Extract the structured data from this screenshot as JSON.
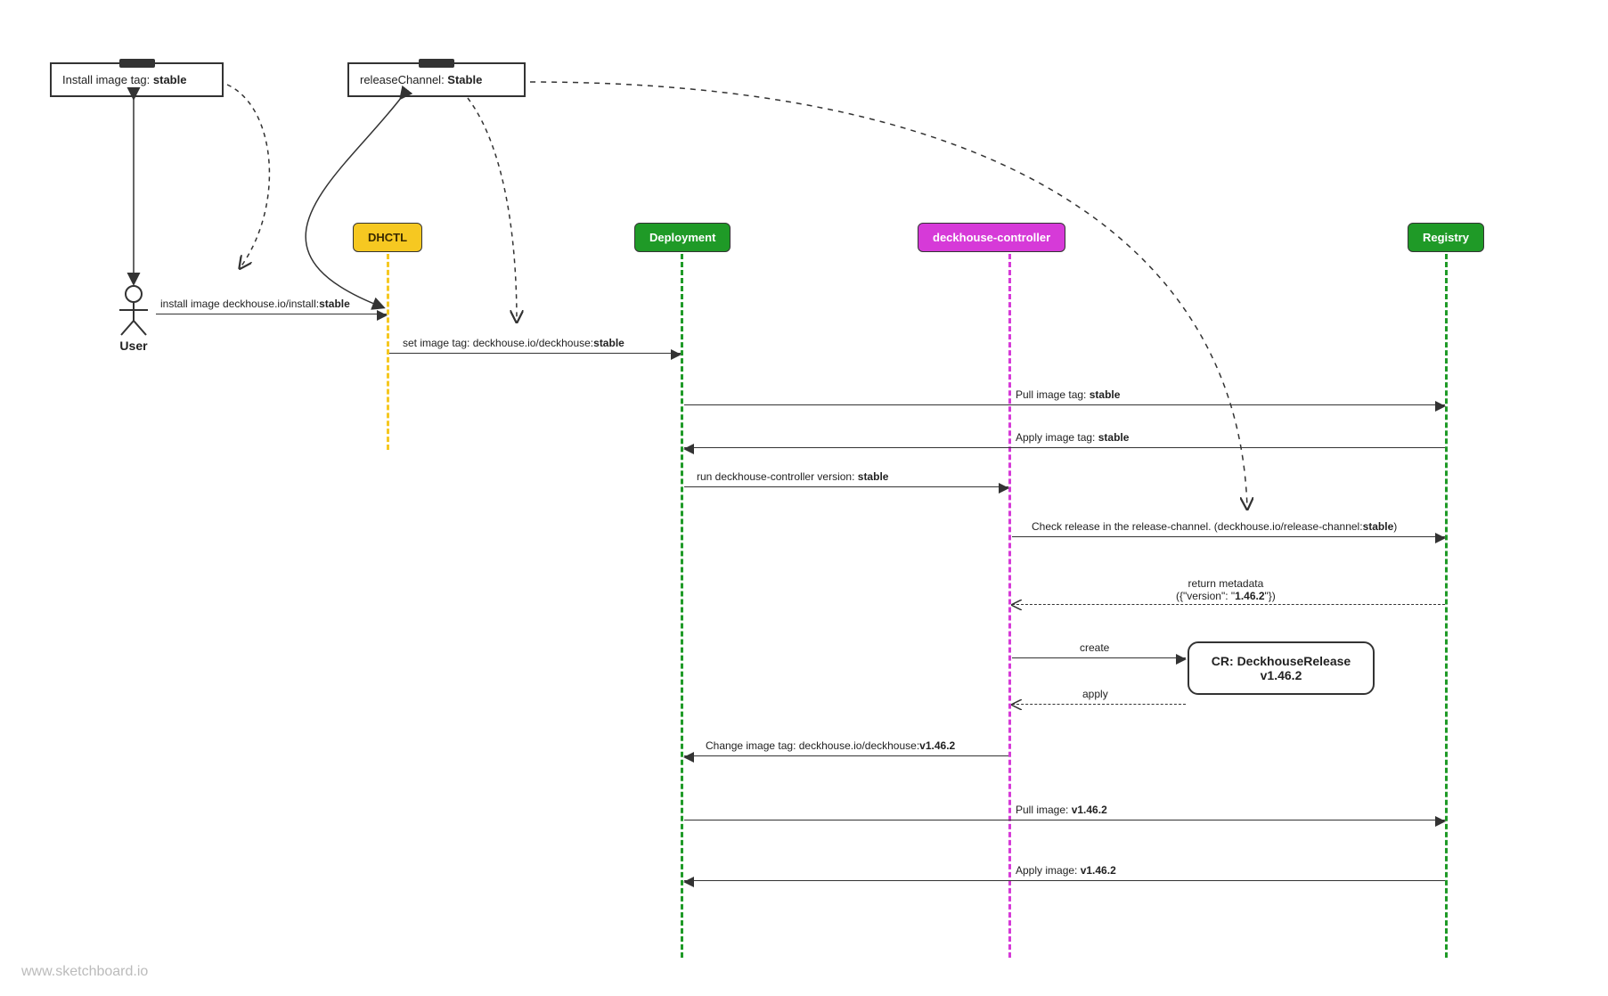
{
  "notes": {
    "install_tag": {
      "prefix": "Install image tag: ",
      "bold": "stable"
    },
    "release_channel": {
      "prefix": "releaseChannel: ",
      "bold": "Stable"
    }
  },
  "lanes": {
    "user": "User",
    "dhctl": "DHCTL",
    "deployment": "Deployment",
    "controller": "deckhouse-controller",
    "registry": "Registry"
  },
  "cr_box": {
    "title": "CR: DeckhouseRelease",
    "subtitle": "v1.46.2"
  },
  "messages": {
    "m1": {
      "prefix": "install image deckhouse.io/install:",
      "bold": "stable"
    },
    "m2": {
      "prefix": "set image tag: deckhouse.io/deckhouse:",
      "bold": "stable"
    },
    "m3": {
      "prefix": "Pull image tag: ",
      "bold": "stable"
    },
    "m4": {
      "prefix": "Apply image tag: ",
      "bold": "stable"
    },
    "m5": {
      "prefix": "run deckhouse-controller version: ",
      "bold": "stable"
    },
    "m6": {
      "prefix": "Check release in the release-channel. (deckhouse.io/release-channel:",
      "bold": "stable",
      "suffix": ")"
    },
    "m7a": {
      "text": "return metadata"
    },
    "m7b": {
      "prefix": "({\"version\": \"",
      "bold": "1.46.2",
      "suffix": "\"})"
    },
    "m8": {
      "text": "create"
    },
    "m9": {
      "text": "apply"
    },
    "m10": {
      "prefix": "Change image tag: deckhouse.io/deckhouse:",
      "bold": "v1.46.2"
    },
    "m11": {
      "prefix": "Pull image: ",
      "bold": "v1.46.2"
    },
    "m12": {
      "prefix": "Apply image: ",
      "bold": "v1.46.2"
    }
  },
  "watermark": "www.sketchboard.io"
}
